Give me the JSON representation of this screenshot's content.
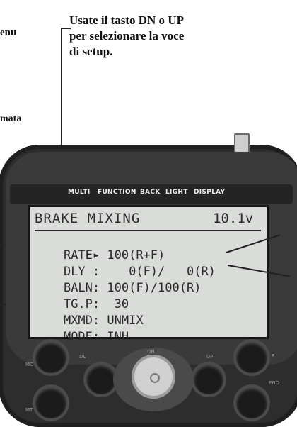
{
  "annotation": {
    "callout_lines": [
      "Usate il tasto DN o UP",
      "per selezionare la voce",
      "di setup."
    ],
    "left_fragment_1": "enu",
    "left_fragment_2": "mata"
  },
  "device": {
    "top_labels": [
      "MULTI",
      "FUNCTION",
      "BACK",
      "LIGHT",
      "DISPLAY"
    ],
    "lcd": {
      "title": "BRAKE MIXING",
      "voltage": "10.1v",
      "rows": [
        {
          "label": "RATE",
          "sep": "▸",
          "value": " 100(R+F)"
        },
        {
          "label": "DLY",
          "sep": " :",
          "value": "    0(F)/   0(R)"
        },
        {
          "label": "BALN",
          "sep": ":",
          "value": " 100(F)/100(R)"
        },
        {
          "label": "TG.P",
          "sep": ":",
          "value": "  30"
        },
        {
          "label": "MXMD",
          "sep": ":",
          "value": " UNMIX"
        },
        {
          "label": "MODE",
          "sep": ":",
          "value": " INH"
        }
      ]
    },
    "button_labels": {
      "left_top": "MC",
      "left_bottom": "MT",
      "center_top": "DN",
      "right_top": "E",
      "right_bottom": "END",
      "left_inner": "DL",
      "right_inner": "UP"
    }
  }
}
